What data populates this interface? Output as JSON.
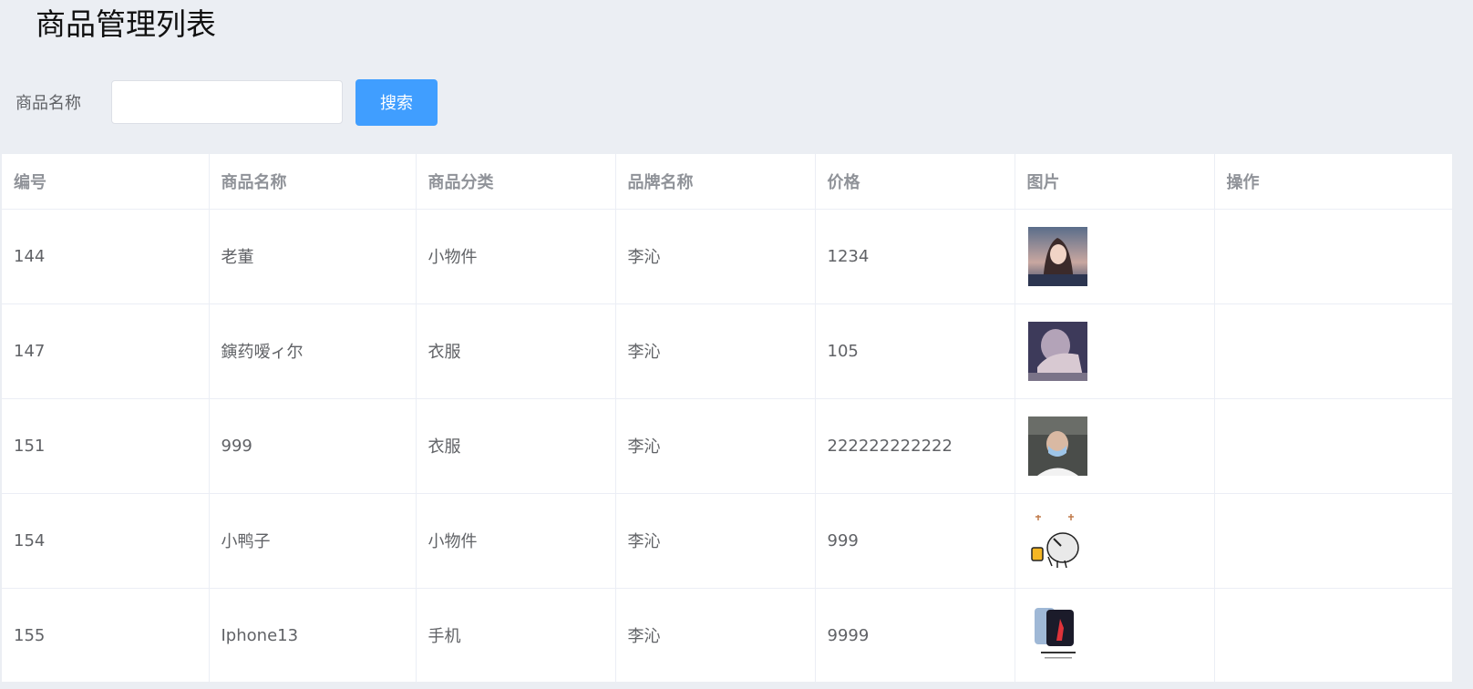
{
  "page": {
    "title": "商品管理列表"
  },
  "search": {
    "label": "商品名称",
    "value": "",
    "placeholder": "",
    "button_label": "搜索"
  },
  "table": {
    "columns": [
      "编号",
      "商品名称",
      "商品分类",
      "品牌名称",
      "价格",
      "图片",
      "操作"
    ],
    "rows": [
      {
        "id": "144",
        "name": "老董",
        "category": "小物件",
        "brand": "李沁",
        "price": "1234",
        "image": "anime-girl-photo"
      },
      {
        "id": "147",
        "name": "鏔药嗳ィ尔",
        "category": "衣服",
        "brand": "李沁",
        "price": "105",
        "image": "hand-portrait-photo"
      },
      {
        "id": "151",
        "name": "999",
        "category": "衣服",
        "brand": "李沁",
        "price": "222222222222",
        "image": "masked-person-photo"
      },
      {
        "id": "154",
        "name": "小鸭子",
        "category": "小物件",
        "brand": "李沁",
        "price": "999",
        "image": "duck-sticker"
      },
      {
        "id": "155",
        "name": "Iphone13",
        "category": "手机",
        "brand": "李沁",
        "price": "9999",
        "image": "phone-product-photo"
      }
    ]
  }
}
